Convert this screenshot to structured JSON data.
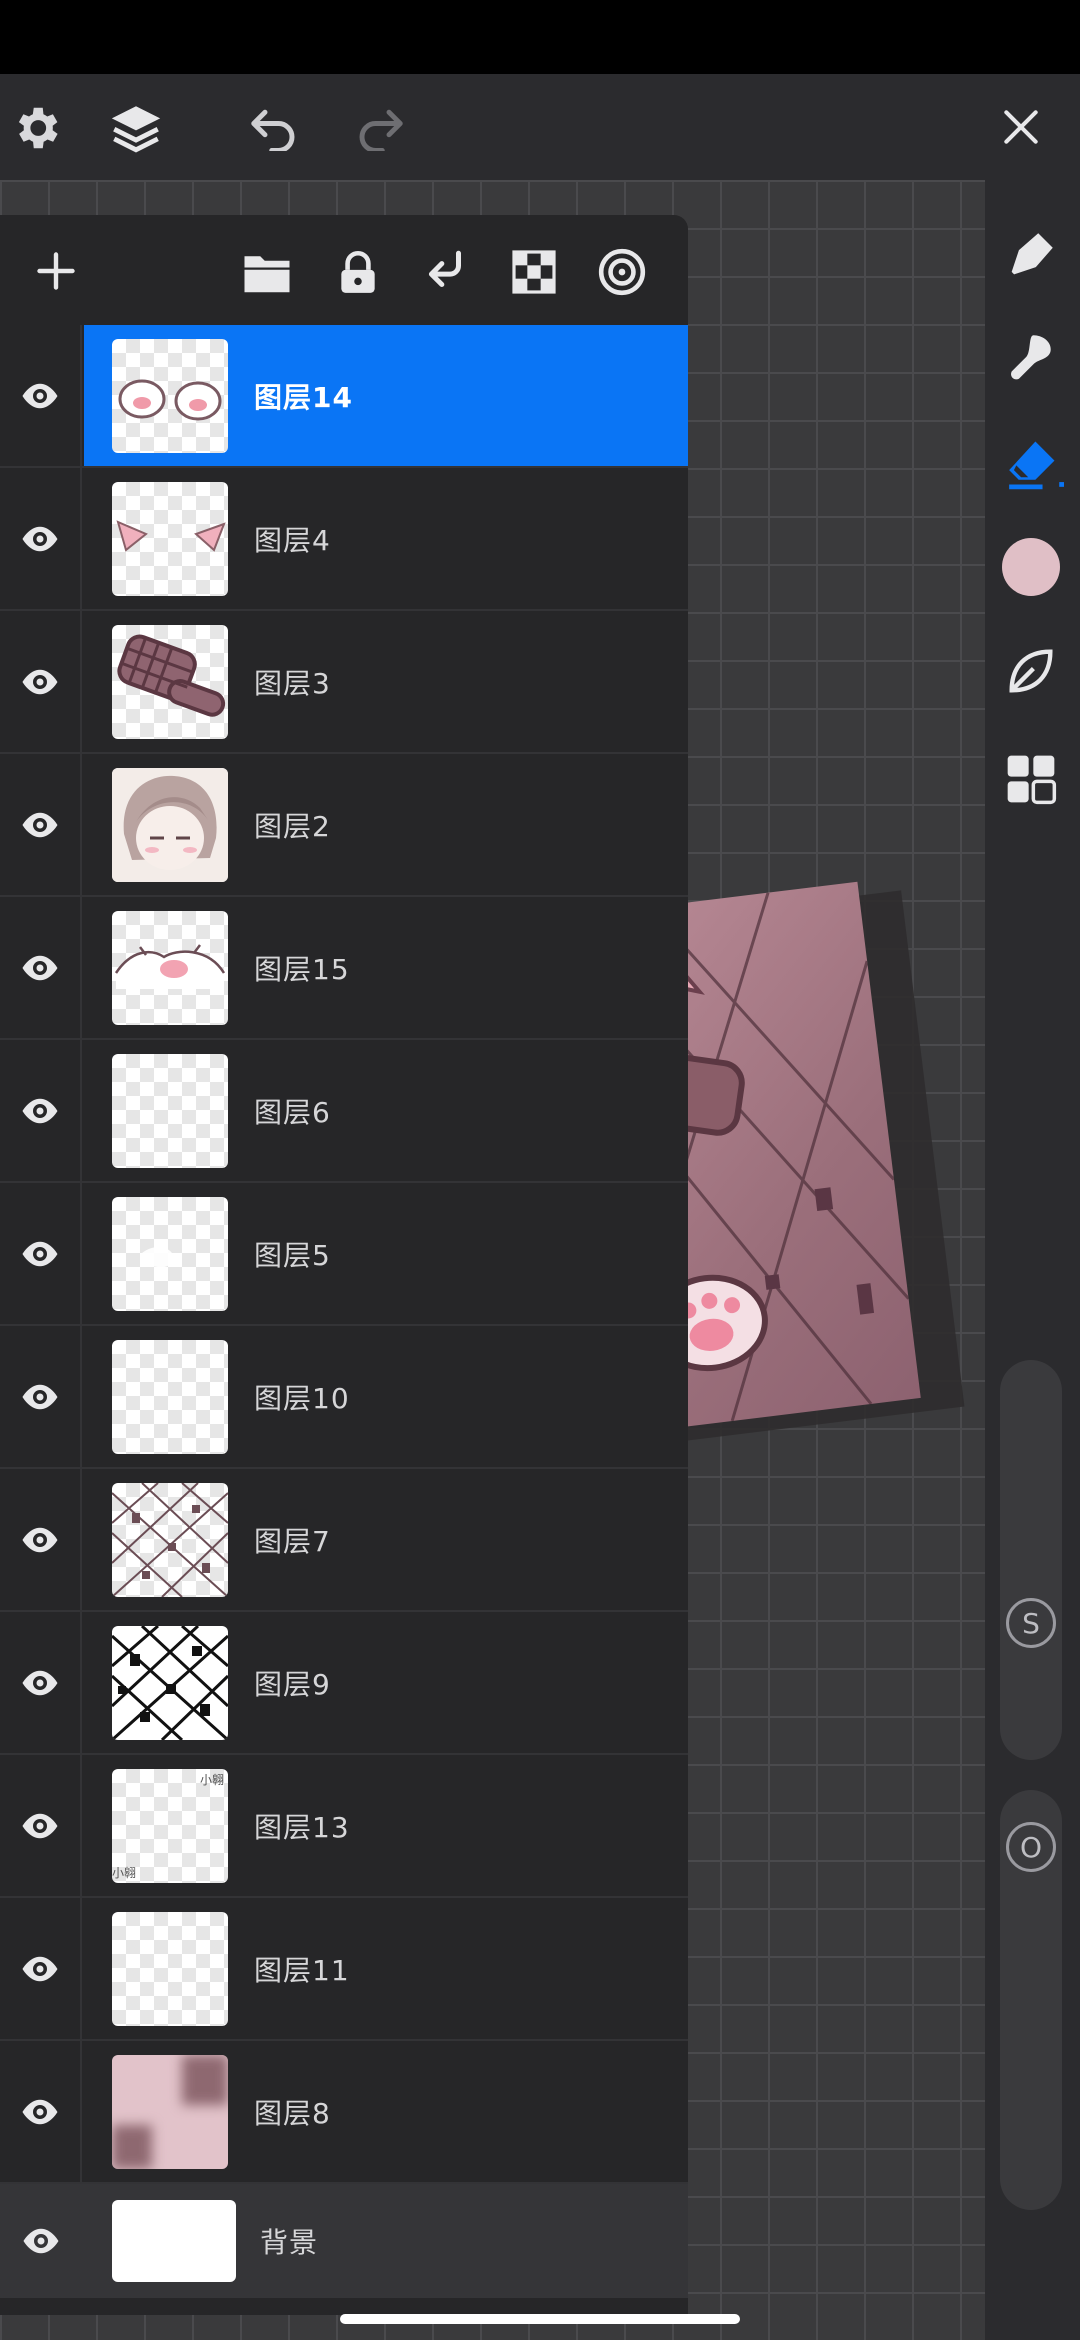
{
  "toolbar": {
    "settings_icon": "gear-icon",
    "layers_icon": "layers-icon",
    "undo_icon": "undo-icon",
    "redo_icon": "redo-icon",
    "close_icon": "close-icon"
  },
  "tools": {
    "items": [
      "pen-tool-icon",
      "smudge-tool-icon",
      "eraser-tool-icon",
      "color-picker",
      "leaf-icon",
      "grid-icon"
    ],
    "current_color": "#e0bfc6"
  },
  "sliders": {
    "size_label": "S",
    "opacity_label": "O"
  },
  "layers": [
    {
      "name": "图层14",
      "selected": true
    },
    {
      "name": "图层4"
    },
    {
      "name": "图层3"
    },
    {
      "name": "图层2"
    },
    {
      "name": "图层15"
    },
    {
      "name": "图层6"
    },
    {
      "name": "图层5"
    },
    {
      "name": "图层10"
    },
    {
      "name": "图层7"
    },
    {
      "name": "图层9"
    },
    {
      "name": "图层13",
      "thumb_text": "小翱"
    },
    {
      "name": "图层11"
    },
    {
      "name": "图层8"
    },
    {
      "name": "背景"
    }
  ],
  "colors": {
    "accent": "#0a75f5",
    "panel": "#262628",
    "toolbar": "#2b2b2e"
  }
}
